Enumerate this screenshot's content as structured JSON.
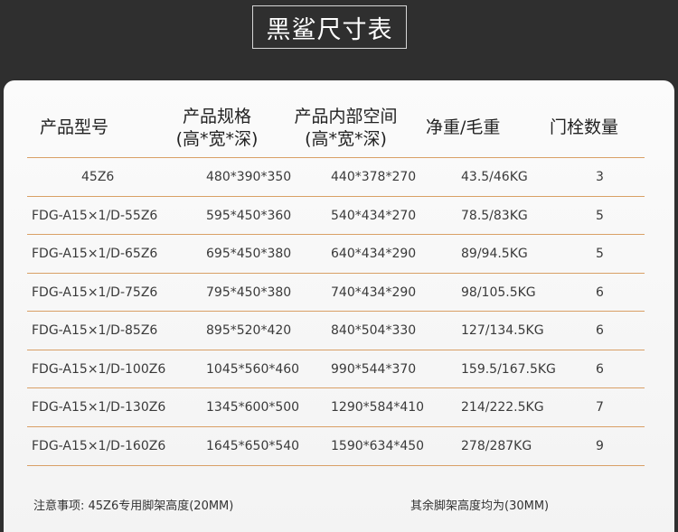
{
  "title": "黑鲨尺寸表",
  "headers": {
    "model": "产品型号",
    "spec_line1": "产品规格",
    "spec_line2": "(高*宽*深)",
    "inner_line1": "产品内部空间",
    "inner_line2": "(高*宽*深)",
    "weight": "净重/毛重",
    "bolts": "门栓数量"
  },
  "rows": [
    {
      "model": "45Z6",
      "spec": "480*390*350",
      "inner": "440*378*270",
      "weight": "43.5/46KG",
      "bolts": "3"
    },
    {
      "model": "FDG-A15×1/D-55Z6",
      "spec": "595*450*360",
      "inner": "540*434*270",
      "weight": "78.5/83KG",
      "bolts": "5"
    },
    {
      "model": "FDG-A15×1/D-65Z6",
      "spec": "695*450*380",
      "inner": "640*434*290",
      "weight": "89/94.5KG",
      "bolts": "5"
    },
    {
      "model": "FDG-A15×1/D-75Z6",
      "spec": "795*450*380",
      "inner": "740*434*290",
      "weight": "98/105.5KG",
      "bolts": "6"
    },
    {
      "model": "FDG-A15×1/D-85Z6",
      "spec": "895*520*420",
      "inner": "840*504*330",
      "weight": "127/134.5KG",
      "bolts": "6"
    },
    {
      "model": "FDG-A15×1/D-100Z6",
      "spec": "1045*560*460",
      "inner": "990*544*370",
      "weight": "159.5/167.5KG",
      "bolts": "6"
    },
    {
      "model": "FDG-A15×1/D-130Z6",
      "spec": "1345*600*500",
      "inner": "1290*584*410",
      "weight": "214/222.5KG",
      "bolts": "7"
    },
    {
      "model": "FDG-A15×1/D-160Z6",
      "spec": "1645*650*540",
      "inner": "1590*634*450",
      "weight": "278/287KG",
      "bolts": "9"
    }
  ],
  "notes": {
    "left": "注意事项: 45Z6专用脚架高度(20MM)",
    "right": "其余脚架高度均为(30MM)"
  },
  "colors": {
    "background": "#2f2f2f",
    "card": "#f7f7f7",
    "separator": "#d9a066"
  }
}
